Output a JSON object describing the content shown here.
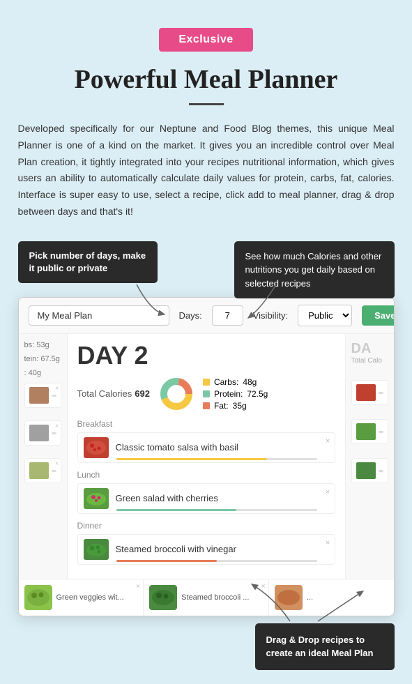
{
  "badge": {
    "label": "Exclusive"
  },
  "header": {
    "title": "Powerful Meal Planner",
    "divider": true
  },
  "description": {
    "text": "Developed specifically for our Neptune and Food Blog themes, this unique Meal Planner is one of a kind on the market. It gives you an incredible control over Meal Plan creation, it tightly integrated into your recipes nutritional information, which gives users an ability to automatically calculate daily values for protein, carbs, fat, calories. Interface is super easy to use, select a recipe, click add to meal planner, drag & drop between days and that's it!"
  },
  "callouts": {
    "left": {
      "text": "Pick number of days, make it public or private"
    },
    "right": {
      "text": "See how much Calories and other nutritions you get daily based on selected recipes"
    },
    "bottom": {
      "text": "Drag & Drop recipes to create an ideal Meal Plan"
    }
  },
  "planner": {
    "name_placeholder": "My Meal Plan",
    "days_label": "Days:",
    "days_value": "7",
    "visibility_label": "Visibility:",
    "visibility_value": "Public",
    "save_label": "Save",
    "day2": {
      "label": "DAY 2",
      "total_calories_label": "Total Calories",
      "total_calories_value": "692",
      "nutrition": {
        "carbs_label": "Carbs:",
        "carbs_value": "48g",
        "protein_label": "Protein:",
        "protein_value": "72.5g",
        "fat_label": "Fat:",
        "fat_value": "35g"
      },
      "meals": {
        "breakfast_label": "Breakfast",
        "breakfast_recipe": "Classic tomato salsa with basil",
        "lunch_label": "Lunch",
        "lunch_recipe": "Green salad with cherries",
        "dinner_label": "Dinner",
        "dinner_recipe": "Steamed broccoli with vinegar"
      }
    },
    "left_col": {
      "nutrition_line1": "bs: 53g",
      "nutrition_line2": "tein: 67.5g",
      "nutrition_line3": ": 40g"
    },
    "right_col": {
      "label": "DA",
      "calories_label": "Total Calo"
    },
    "bottom_thumbs": [
      {
        "label": "Green veggies wit..."
      },
      {
        "label": "Steamed broccoli ..."
      },
      {
        "label": "..."
      }
    ]
  },
  "colors": {
    "carbs": "#f5c842",
    "protein": "#7bc8a4",
    "fat": "#e87c5a",
    "save_btn": "#4caf72",
    "badge": "#e84c88",
    "callout_bg": "#2a2a2a"
  }
}
